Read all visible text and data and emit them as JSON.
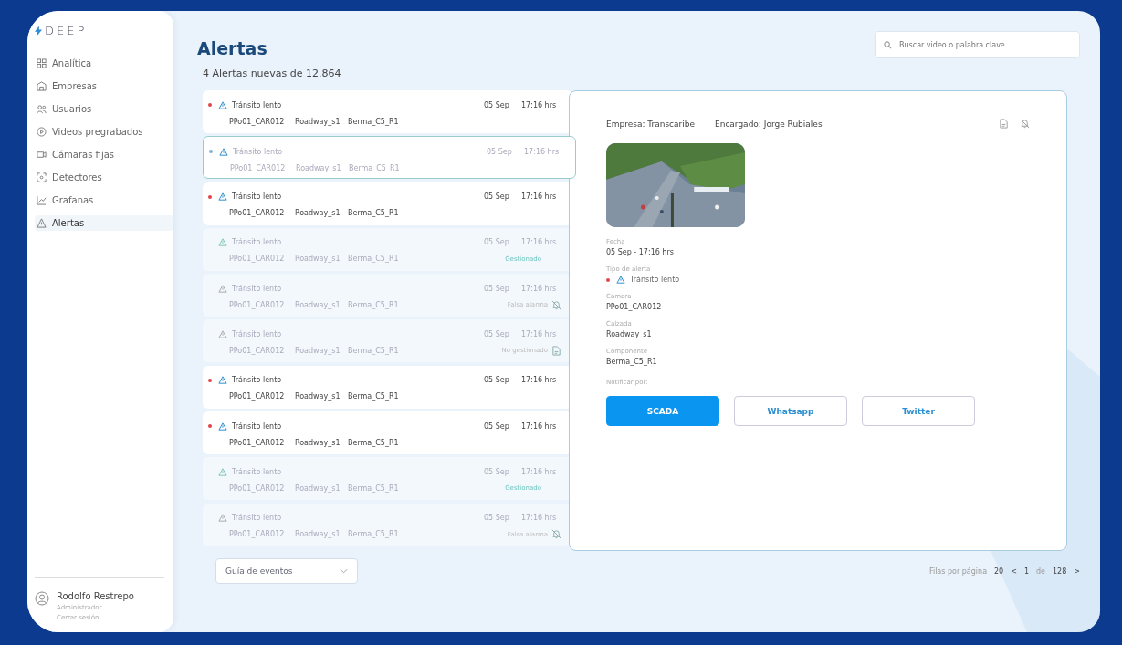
{
  "brand": "DEEP",
  "sidebar": {
    "items": [
      {
        "label": "Analítica",
        "selected": false
      },
      {
        "label": "Empresas",
        "selected": false
      },
      {
        "label": "Usuarios",
        "selected": false
      },
      {
        "label": "Videos pregrabados",
        "selected": false
      },
      {
        "label": "Cámaras fijas",
        "selected": false
      },
      {
        "label": "Detectores",
        "selected": false
      },
      {
        "label": "Grafanas",
        "selected": false
      },
      {
        "label": "Alertas",
        "selected": true
      }
    ],
    "user": {
      "name": "Rodolfo Restrepo",
      "role": "Administrador",
      "logout": "Cerrar sesión"
    }
  },
  "page": {
    "title": "Alertas",
    "subtitle": "4 Alertas nuevas de 12.864",
    "search": {
      "placeholder": "Buscar video o palabra clave"
    }
  },
  "alerts": [
    {
      "type": "Tránsito lento",
      "date": "05 Sep",
      "time": "17:16 hrs",
      "camera": "PPo01_CAR012",
      "road": "Roadway_s1",
      "component": "Berma_C5_R1",
      "unread": true,
      "selected": false
    },
    {
      "type": "Tránsito lento",
      "date": "05 Sep",
      "time": "17:16 hrs",
      "camera": "PPo01_CAR012",
      "road": "Roadway_s1",
      "component": "Berma_C5_R1",
      "unread": false,
      "selected": true
    },
    {
      "type": "Tránsito lento",
      "date": "05 Sep",
      "time": "17:16 hrs",
      "camera": "PPo01_CAR012",
      "road": "Roadway_s1",
      "component": "Berma_C5_R1",
      "unread": true,
      "selected": false
    },
    {
      "type": "Tránsito lento",
      "date": "05 Sep",
      "time": "17:16 hrs",
      "camera": "PPo01_CAR012",
      "road": "Roadway_s1",
      "component": "Berma_C5_R1",
      "unread": false,
      "selected": false,
      "status": {
        "kind": "managed",
        "text": "Gestionado"
      }
    },
    {
      "type": "Tránsito lento",
      "date": "05 Sep",
      "time": "17:16 hrs",
      "camera": "PPo01_CAR012",
      "road": "Roadway_s1",
      "component": "Berma_C5_R1",
      "unread": false,
      "selected": false,
      "status": {
        "kind": "false_alarm",
        "text": "Falsa alarma"
      }
    },
    {
      "type": "Tránsito lento",
      "date": "05 Sep",
      "time": "17:16 hrs",
      "camera": "PPo01_CAR012",
      "road": "Roadway_s1",
      "component": "Berma_C5_R1",
      "unread": false,
      "selected": false,
      "status": {
        "kind": "unmanaged",
        "text": "No gestionado"
      }
    },
    {
      "type": "Tránsito lento",
      "date": "05 Sep",
      "time": "17:16 hrs",
      "camera": "PPo01_CAR012",
      "road": "Roadway_s1",
      "component": "Berma_C5_R1",
      "unread": true,
      "selected": false
    },
    {
      "type": "Tránsito lento",
      "date": "05 Sep",
      "time": "17:16 hrs",
      "camera": "PPo01_CAR012",
      "road": "Roadway_s1",
      "component": "Berma_C5_R1",
      "unread": true,
      "selected": false
    },
    {
      "type": "Tránsito lento",
      "date": "05 Sep",
      "time": "17:16 hrs",
      "camera": "PPo01_CAR012",
      "road": "Roadway_s1",
      "component": "Berma_C5_R1",
      "unread": false,
      "selected": false,
      "status": {
        "kind": "managed",
        "text": "Gestionado"
      }
    },
    {
      "type": "Tránsito lento",
      "date": "05 Sep",
      "time": "17:16 hrs",
      "camera": "PPo01_CAR012",
      "road": "Roadway_s1",
      "component": "Berma_C5_R1",
      "unread": false,
      "selected": false,
      "status": {
        "kind": "false_alarm",
        "text": "Falsa alarma"
      }
    }
  ],
  "detail": {
    "company": "Empresa: Transcaribe",
    "manager": "Encargado: Jorge Rubiales",
    "fields": [
      {
        "label": "Fecha",
        "value": "05 Sep - 17:16 hrs",
        "kind": "text"
      },
      {
        "label": "Tipo de alerta",
        "value": "Tránsito lento",
        "kind": "alert"
      },
      {
        "label": "Cámara",
        "value": "PPo01_CAR012",
        "kind": "text"
      },
      {
        "label": "Calzada",
        "value": "Roadway_s1",
        "kind": "text"
      },
      {
        "label": "Componente",
        "value": "Berma_C5_R1",
        "kind": "text"
      }
    ],
    "notify_label": "Notificar por:",
    "notify": [
      {
        "label": "SCADA",
        "selected": true
      },
      {
        "label": "Whatsapp",
        "selected": false
      },
      {
        "label": "Twitter",
        "selected": false
      }
    ]
  },
  "footer": {
    "dropdown": "Guía de eventos",
    "rows_label": "Filas por página",
    "rows": "20",
    "prev": "<",
    "page": "1",
    "of": "de",
    "total": "128",
    "next": ">"
  }
}
